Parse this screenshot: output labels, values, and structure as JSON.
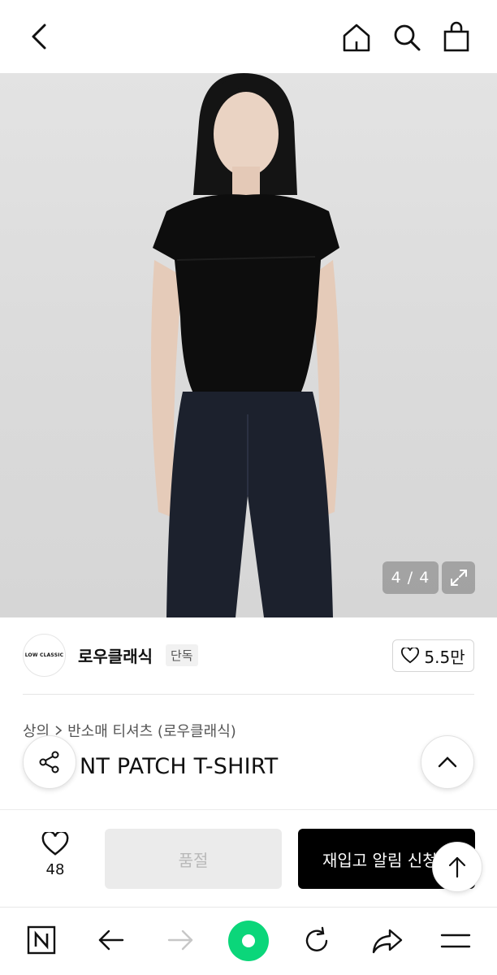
{
  "header": {
    "icons": [
      "back-icon",
      "home-icon",
      "search-icon",
      "shopping-bag-icon"
    ]
  },
  "gallery": {
    "counter": "4 / 4"
  },
  "brand": {
    "logo_text": "LOW CLASSIC",
    "name": "로우클래식",
    "badge": "단독",
    "likes": "5.5만"
  },
  "product": {
    "breadcrumb": [
      "상의",
      "반소매 티셔츠 (로우클래식)"
    ],
    "title": "FRONT PATCH T-SHIRT",
    "visible_title": "NT PATCH T-SHIRT"
  },
  "purchase": {
    "wish_count": "48",
    "soldout_label": "품절",
    "restock_label": "재입고 알림 신청"
  },
  "browser": {
    "icons": [
      "naver-icon",
      "back-arrow-icon",
      "forward-arrow-icon",
      "green-dot-icon",
      "reload-icon",
      "share-arrow-icon",
      "menu-icon"
    ]
  },
  "colors": {
    "accent_green": "#0bd67a",
    "black": "#000000"
  }
}
